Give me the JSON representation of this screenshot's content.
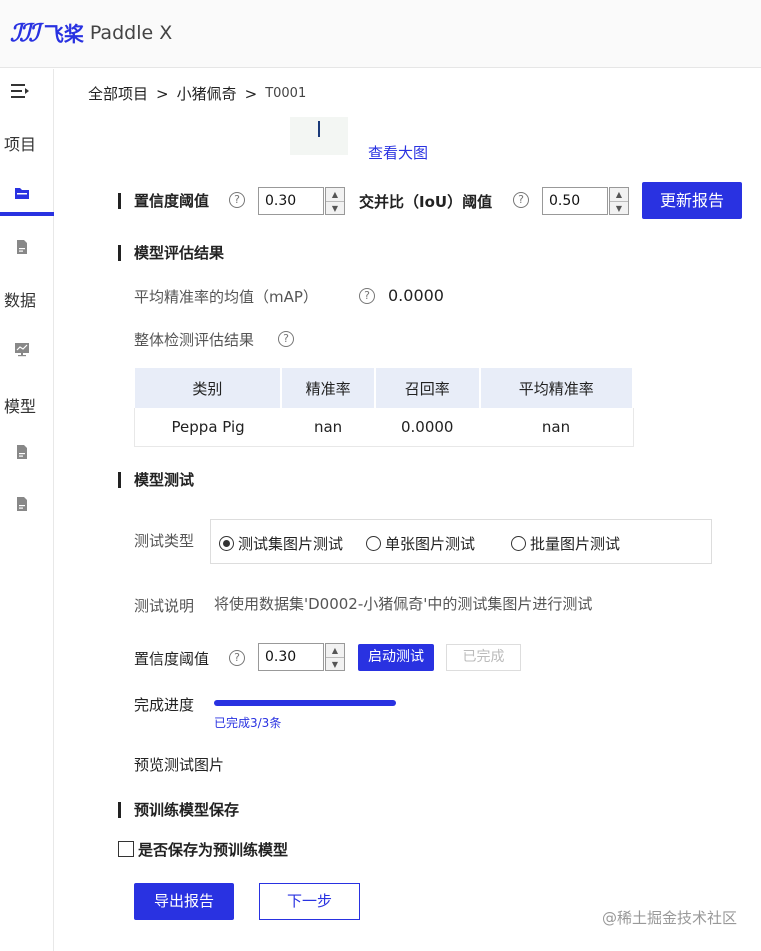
{
  "app": {
    "logo_mark": "ℐℐℐ",
    "brand_cn": "飞桨",
    "brand_en": "Paddle X"
  },
  "sidebar": {
    "items": [
      "项目",
      "数据",
      "模型"
    ]
  },
  "breadcrumb": {
    "root": "全部项目",
    "project": "小猪佩奇",
    "current": "T0001",
    "separator": ">"
  },
  "preview": {
    "view_large": "查看大图"
  },
  "thresholds": {
    "confidence_label": "置信度阈值",
    "confidence_value": "0.30",
    "iou_label": "交并比（IoU）阈值",
    "iou_value": "0.50",
    "update_button": "更新报告"
  },
  "evaluation": {
    "title": "模型评估结果",
    "map_label": "平均精准率的均值（mAP）",
    "map_value": "0.0000",
    "overall_label": "整体检测评估结果",
    "columns": [
      "类别",
      "精准率",
      "召回率",
      "平均精准率"
    ],
    "rows": [
      [
        "Peppa Pig",
        "nan",
        "0.0000",
        "nan"
      ]
    ]
  },
  "testing": {
    "title": "模型测试",
    "type_label": "测试类型",
    "options": [
      "测试集图片测试",
      "单张图片测试",
      "批量图片测试"
    ],
    "selected_option": "测试集图片测试",
    "desc_label": "测试说明",
    "desc_text": "将使用数据集'D0002-小猪佩奇'中的测试集图片进行测试",
    "confidence_label": "置信度阈值",
    "confidence_value": "0.30",
    "start_button": "启动测试",
    "done_button": "已完成",
    "progress_label": "完成进度",
    "progress_fraction": 1.0,
    "progress_text": "已完成3/3条",
    "preview_link": "预览测试图片"
  },
  "pretrain": {
    "title": "预训练模型保存",
    "checkbox_label": "是否保存为预训练模型",
    "checked": false
  },
  "footer": {
    "export_button": "导出报告",
    "next_button": "下一步"
  },
  "watermark": "@稀土掘金技术社区",
  "colors": {
    "accent": "#2932e1",
    "header_bg": "#e8edf8"
  }
}
